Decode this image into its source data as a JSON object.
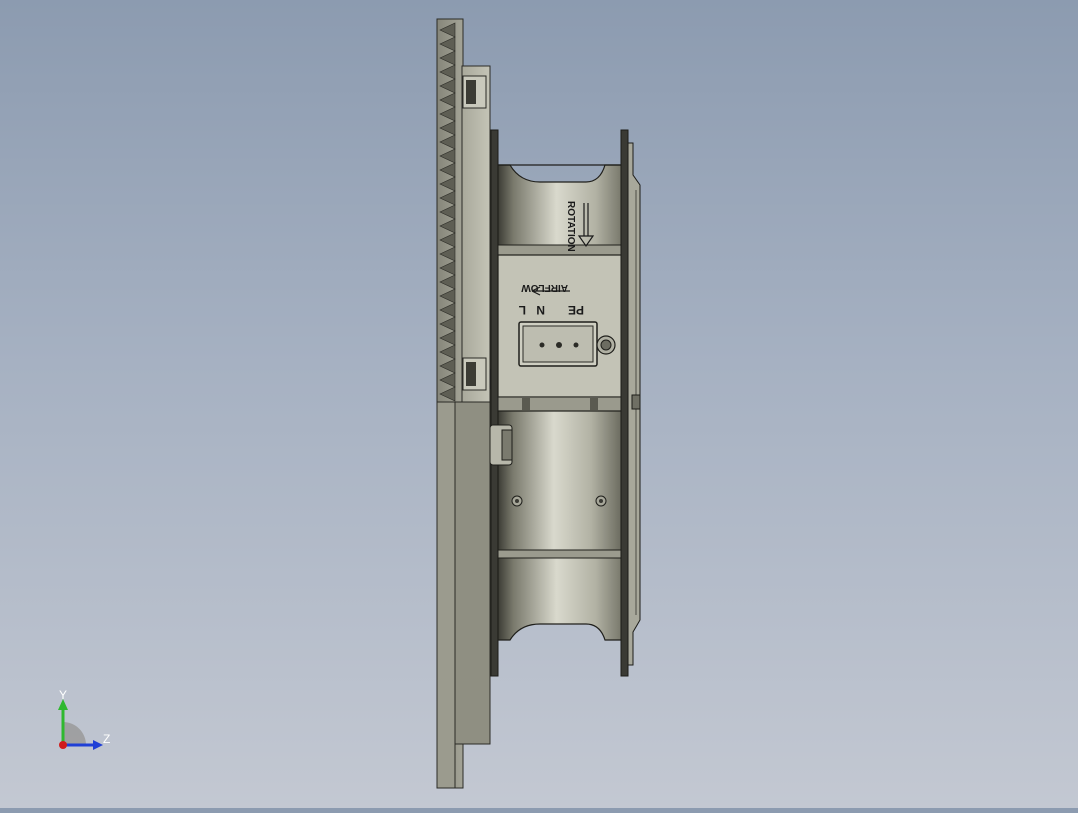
{
  "model": {
    "labels": {
      "rotation": "ROTATION",
      "airflow": "AIRFLOW",
      "terminal_pe": "PE",
      "terminal_n": "N",
      "terminal_l": "L"
    }
  },
  "triad": {
    "y_label": "Y",
    "z_label": "Z",
    "colors": {
      "y": "#2fb82f",
      "z": "#1f3fd6",
      "x": "#d01c1c"
    }
  },
  "colors": {
    "background_top": "#8c9bb0",
    "background_bottom": "#c3c8d2",
    "part_light": "#b9b9ab",
    "part_mid": "#8d8d80",
    "part_dark": "#4a4a42"
  }
}
